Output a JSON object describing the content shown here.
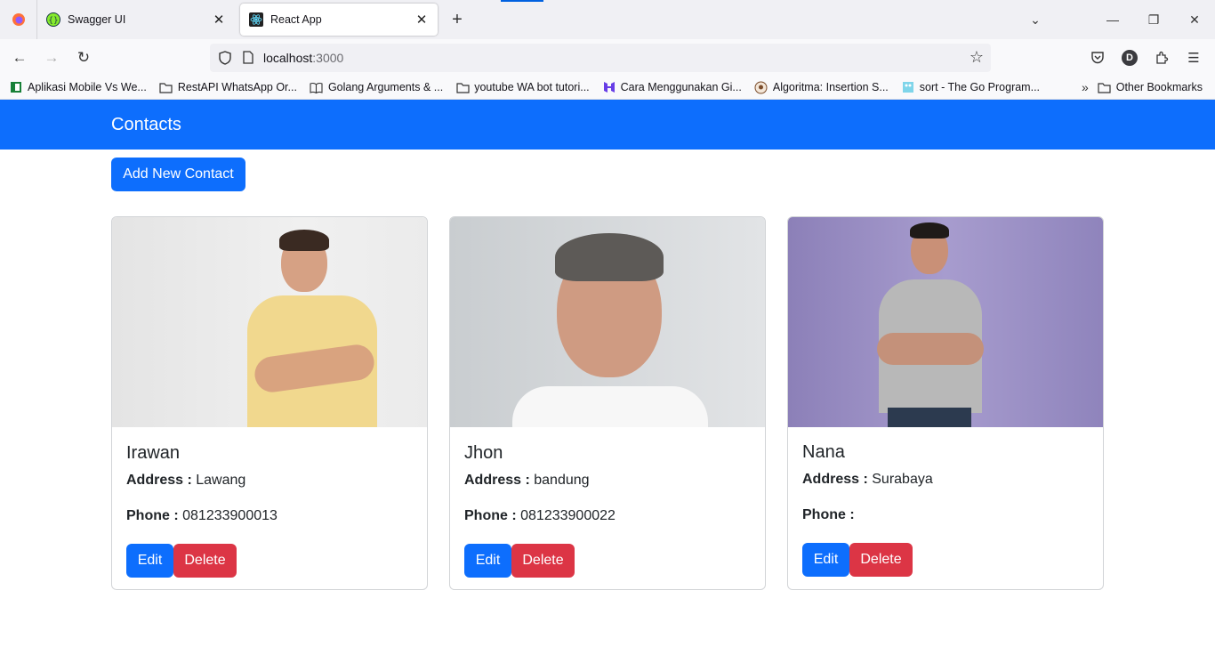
{
  "browser": {
    "tabs": [
      {
        "title": "Swagger UI",
        "active": false
      },
      {
        "title": "React App",
        "active": true
      }
    ],
    "address": {
      "host": "localhost",
      "port": ":3000"
    },
    "profile_initial": "D",
    "bookmarks": [
      "Aplikasi Mobile Vs We...",
      "RestAPI WhatsApp Or...",
      "Golang Arguments & ...",
      "youtube WA bot tutori...",
      "Cara Menggunakan Gi...",
      "Algoritma: Insertion S...",
      "sort - The Go Program..."
    ],
    "other_bookmarks": "Other Bookmarks"
  },
  "app": {
    "brand": "Contacts",
    "add_button": "Add New Contact",
    "labels": {
      "address": "Address :",
      "phone": "Phone :",
      "edit": "Edit",
      "delete": "Delete"
    },
    "contacts": [
      {
        "name": "Irawan",
        "address": "Lawang",
        "phone": "081233900013"
      },
      {
        "name": "Jhon",
        "address": "bandung",
        "phone": "081233900022"
      },
      {
        "name": "Nana",
        "address": "Surabaya",
        "phone": ""
      }
    ]
  },
  "colors": {
    "primary": "#0d6efd",
    "danger": "#dc3545"
  }
}
